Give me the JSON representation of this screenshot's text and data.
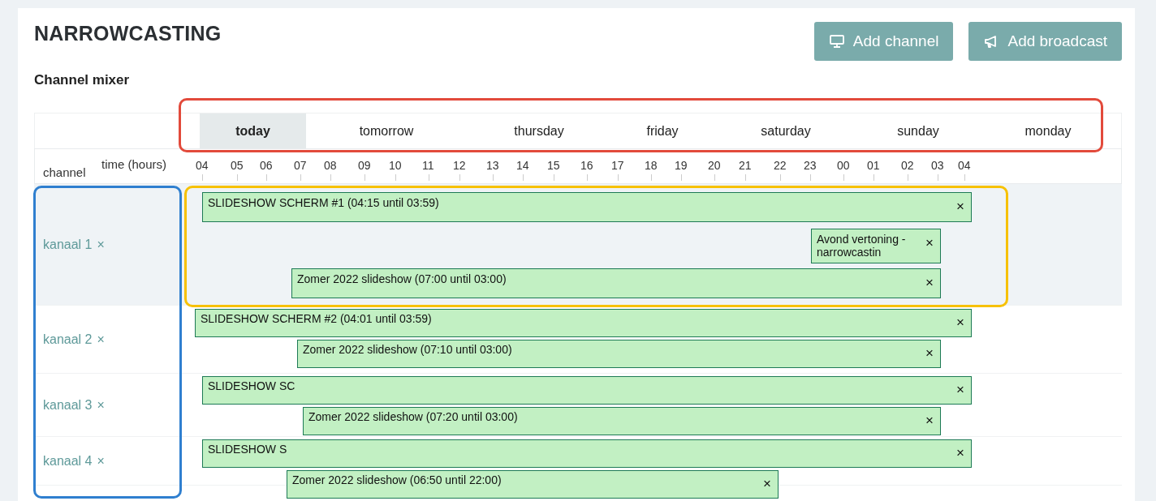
{
  "title": "NARROWCASTING",
  "buttons": [
    {
      "label": "Add channel"
    },
    {
      "label": "Add broadcast"
    }
  ],
  "section_title": "Channel mixer",
  "days": [
    {
      "label": "today",
      "selected": true
    },
    {
      "label": "tomorrow",
      "selected": false
    },
    {
      "label": "thursday",
      "selected": false
    },
    {
      "label": "friday",
      "selected": false
    },
    {
      "label": "saturday",
      "selected": false
    },
    {
      "label": "sunday",
      "selected": false
    },
    {
      "label": "monday",
      "selected": false
    }
  ],
  "axis": {
    "channel_label": "channel",
    "time_label": "time (hours)",
    "hours": [
      "04",
      "05",
      "06",
      "07",
      "08",
      "09",
      "10",
      "11",
      "12",
      "13",
      "14",
      "15",
      "16",
      "17",
      "18",
      "19",
      "20",
      "21",
      "22",
      "23",
      "00",
      "01",
      "02",
      "03",
      "04"
    ]
  },
  "channels": [
    {
      "name": "kanaal 1",
      "remove": "×",
      "selected": true,
      "broadcasts": [
        {
          "title": "SLIDESHOW SCHERM #1 (04:15 until 03:59)",
          "remove": "×"
        },
        {
          "title": "Avond vertoning - narrowcastin",
          "remove": "×"
        },
        {
          "title": "Zomer 2022 slideshow (07:00 until 03:00)",
          "remove": "×"
        }
      ]
    },
    {
      "name": "kanaal 2",
      "remove": "×",
      "selected": false,
      "broadcasts": [
        {
          "title": "SLIDESHOW SCHERM #2 (04:01 until 03:59)",
          "remove": "×"
        },
        {
          "title": "Zomer 2022 slideshow (07:10 until 03:00)",
          "remove": "×"
        }
      ]
    },
    {
      "name": "kanaal 3",
      "remove": "×",
      "selected": false,
      "broadcasts": [
        {
          "title": "SLIDESHOW SC",
          "remove": "×"
        },
        {
          "title": "Zomer 2022 slideshow (07:20 until 03:00)",
          "remove": "×"
        }
      ]
    },
    {
      "name": "kanaal 4",
      "remove": "×",
      "selected": false,
      "broadcasts": [
        {
          "title": "SLIDESHOW S",
          "remove": "×"
        },
        {
          "title": "Zomer 2022 slideshow (06:50 until 22:00)",
          "remove": "×"
        }
      ]
    }
  ],
  "highlights": [
    {
      "color": "#e24a3b"
    },
    {
      "color": "#2f7fcf"
    },
    {
      "color": "#f7c100"
    }
  ]
}
